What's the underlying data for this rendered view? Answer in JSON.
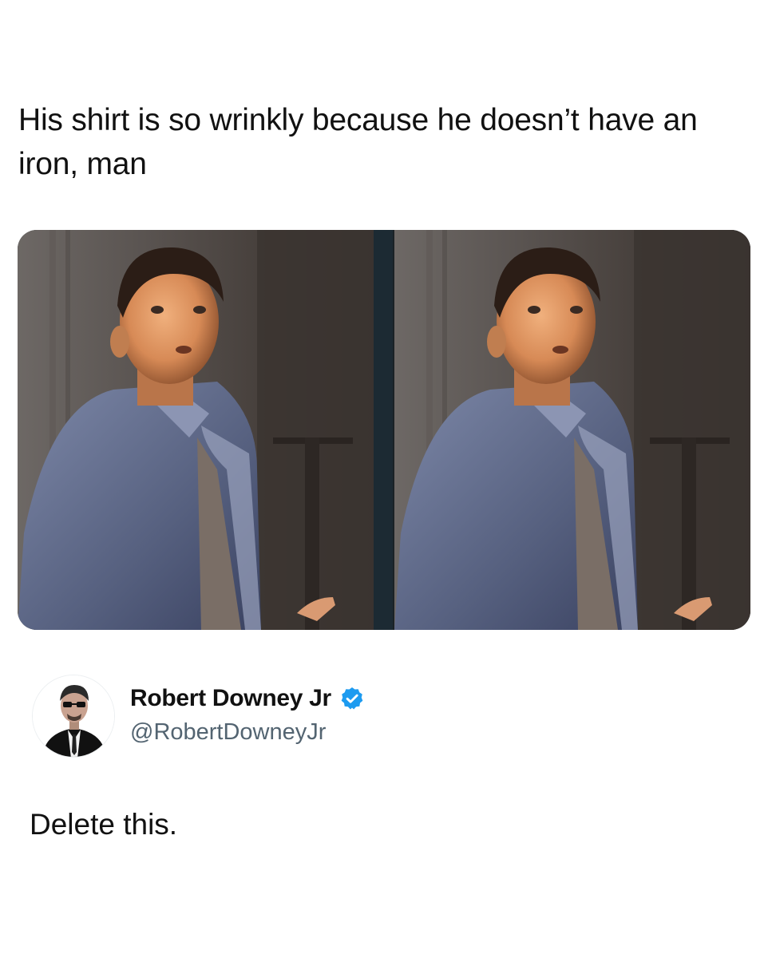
{
  "post": {
    "text_line1": "His shirt is so wrinkly because he doesn’t have an",
    "text_line2": "iron, man",
    "media": {
      "panels": 2,
      "description_icon": "photo-icon"
    }
  },
  "author": {
    "display_name": "Robert Downey Jr",
    "handle": "@RobertDowneyJr",
    "verified": true,
    "verified_color": "#1d9bf0",
    "avatar_icon": "profile-avatar-icon"
  },
  "reply": {
    "text": "Delete this."
  },
  "colors": {
    "background": "#ffffff",
    "text": "#111111",
    "handle": "#536471",
    "accent": "#1d9bf0"
  }
}
